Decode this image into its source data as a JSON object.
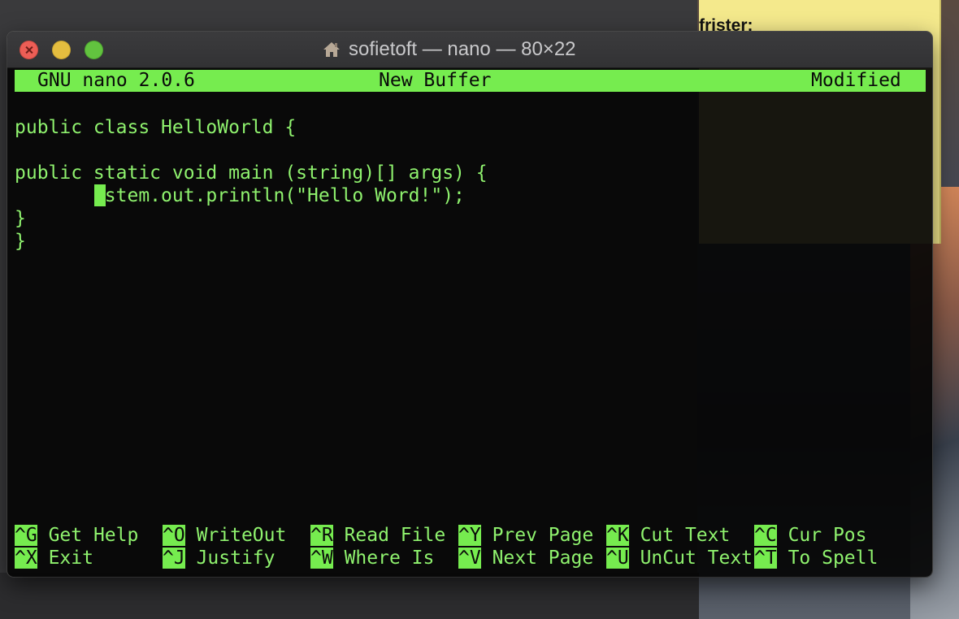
{
  "desktop": {
    "sticky_note_text": "frister:"
  },
  "window": {
    "title": "sofietoft — nano — 80×22",
    "icons": {
      "title_icon": "home-icon",
      "close": "close-icon",
      "minimize": "minimize-icon",
      "zoom": "zoom-icon"
    }
  },
  "nano": {
    "version": "GNU nano 2.0.6",
    "buffer_name": "New Buffer",
    "status": "Modified",
    "lines": [
      "",
      "public class HelloWorld {",
      "",
      "public static void main (string)[] args) {",
      "       ystem.out.println(\"Hello Word!\");",
      "}",
      "}"
    ],
    "shortcuts_row1": [
      {
        "key": "^G",
        "label": "Get Help"
      },
      {
        "key": "^O",
        "label": "WriteOut"
      },
      {
        "key": "^R",
        "label": "Read File"
      },
      {
        "key": "^Y",
        "label": "Prev Page"
      },
      {
        "key": "^K",
        "label": "Cut Text"
      },
      {
        "key": "^C",
        "label": "Cur Pos"
      }
    ],
    "shortcuts_row2": [
      {
        "key": "^X",
        "label": "Exit"
      },
      {
        "key": "^J",
        "label": "Justify"
      },
      {
        "key": "^W",
        "label": "Where Is"
      },
      {
        "key": "^V",
        "label": "Next Page"
      },
      {
        "key": "^U",
        "label": "UnCut Text"
      },
      {
        "key": "^T",
        "label": "To Spell"
      }
    ]
  },
  "colors": {
    "terminal_text": "#8ff26e",
    "highlight": "#76ec4f",
    "terminal_bg": "#050505"
  }
}
